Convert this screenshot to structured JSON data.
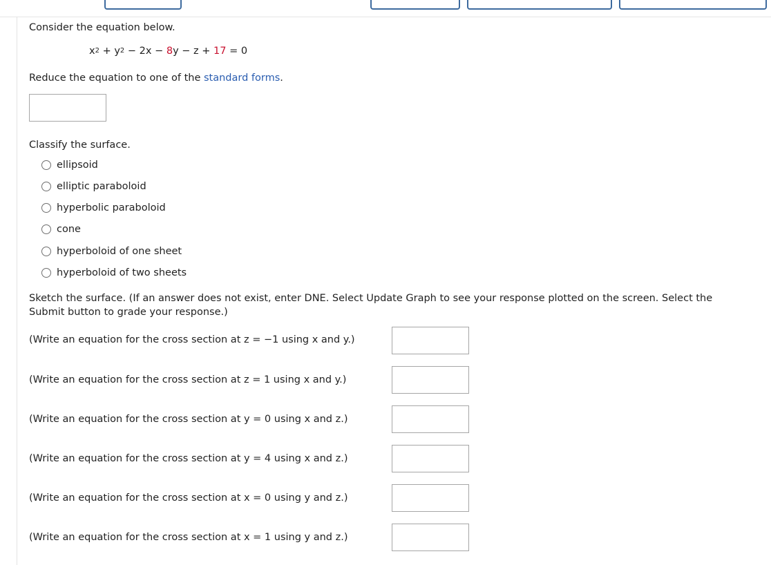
{
  "question": {
    "intro": "Consider the equation below.",
    "equation": {
      "p1": "x",
      "exp1": "2",
      "p2": " + y",
      "exp2": "2",
      "p3": " − 2x − ",
      "c1": "8",
      "p4": "y − z + ",
      "c2": "17",
      "p5": " = 0"
    },
    "reduce_prefix": "Reduce the equation to one of the ",
    "reduce_link": "standard forms",
    "reduce_suffix": ".",
    "standard_form_value": "",
    "classify_label": "Classify the surface.",
    "options": [
      "ellipsoid",
      "elliptic paraboloid",
      "hyperbolic paraboloid",
      "cone",
      "hyperboloid of one sheet",
      "hyperboloid of two sheets"
    ],
    "sketch_instructions": "Sketch the surface. (If an answer does not exist, enter DNE. Select Update Graph to see your response plotted on the screen. Select the Submit button to grade your response.)"
  },
  "cross_sections": [
    {
      "prompt": "(Write an equation for the cross section at z = −1 using x and y.)",
      "value": ""
    },
    {
      "prompt": "(Write an equation for the cross section at z = 1 using x and y.)",
      "value": ""
    },
    {
      "prompt": "(Write an equation for the cross section at y = 0 using x and z.)",
      "value": ""
    },
    {
      "prompt": "(Write an equation for the cross section at y = 4 using x and z.)",
      "value": ""
    },
    {
      "prompt": "(Write an equation for the cross section at x = 0 using y and z.)",
      "value": ""
    },
    {
      "prompt": "(Write an equation for the cross section at x = 1 using y and z.)",
      "value": ""
    }
  ],
  "colors": {
    "constant_red": "#c8102e",
    "link_blue": "#2a5db0",
    "toolbar_button_border": "#3d6a9e"
  }
}
